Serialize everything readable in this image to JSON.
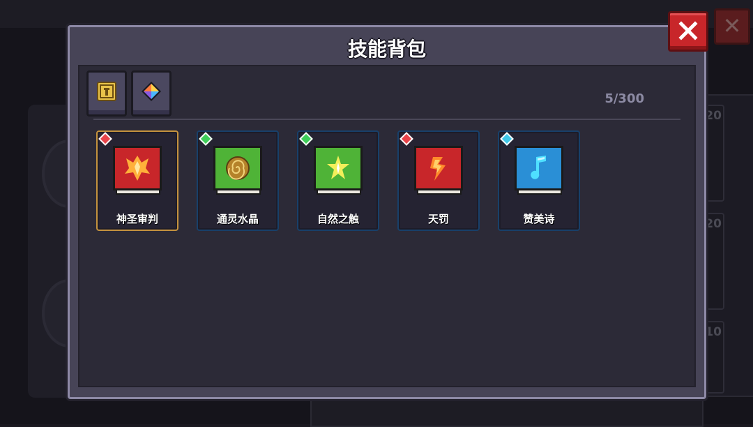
{
  "dialog": {
    "title": "技能背包",
    "count": "5/300"
  },
  "filters": [
    {
      "icon": "idol-icon",
      "color": "#e8c34a"
    },
    {
      "icon": "crystal-icon",
      "color": "#b48ce8"
    }
  ],
  "skills": [
    {
      "name": "神圣审判",
      "rarity_color": "#e8434a",
      "cover_color": "#c8262a",
      "emblem": "flame-wings-icon",
      "selected": true
    },
    {
      "name": "通灵水晶",
      "rarity_color": "#3fcf5a",
      "cover_color": "#4fb337",
      "emblem": "spiral-orb-icon",
      "selected": false
    },
    {
      "name": "自然之触",
      "rarity_color": "#3fcf5a",
      "cover_color": "#4fb337",
      "emblem": "leaf-star-icon",
      "selected": false
    },
    {
      "name": "天罚",
      "rarity_color": "#e8434a",
      "cover_color": "#c8262a",
      "emblem": "strike-icon",
      "selected": false
    },
    {
      "name": "赞美诗",
      "rarity_color": "#40c8e8",
      "cover_color": "#2a8fd6",
      "emblem": "music-note-icon",
      "selected": false
    }
  ],
  "background": {
    "slot_levels": [
      "20",
      "20",
      "10"
    ]
  }
}
